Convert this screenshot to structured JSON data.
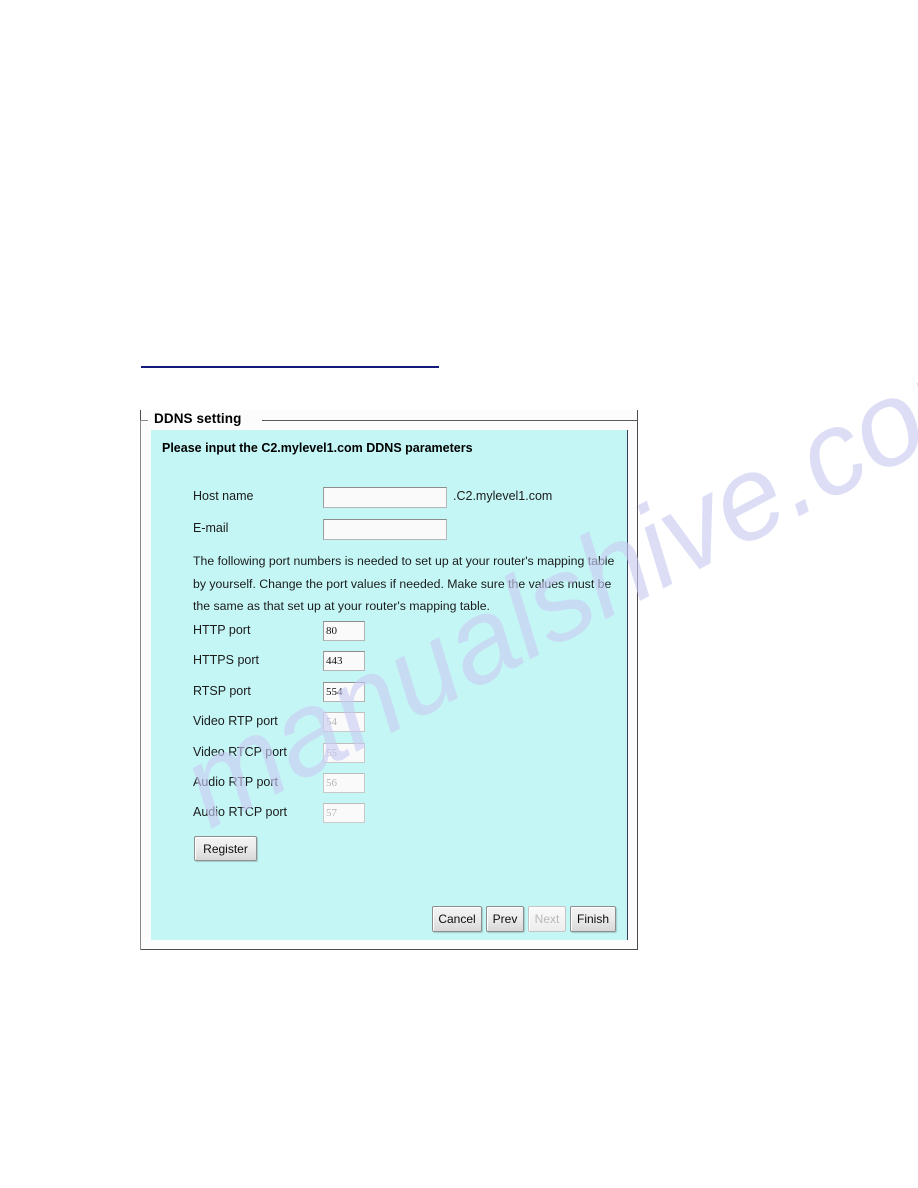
{
  "page": {
    "background_color": "#ffffff",
    "rule_color": "#141b7a"
  },
  "watermark": {
    "text": "manualshive.com",
    "color": "#c9cbf2"
  },
  "fieldset": {
    "legend": "DDNS setting"
  },
  "panel": {
    "background_color": "#c5f6f6",
    "heading": "Please input the C2.mylevel1.com DDNS parameters",
    "note": [
      "The following port numbers is needed to set up at your router's mapping table",
      "by yourself. Change the port values if needed. Make sure the values must be",
      "the same as that set up at your router's mapping table."
    ]
  },
  "fields": {
    "host_name": {
      "label": "Host name",
      "value": "",
      "suffix": ".C2.mylevel1.com"
    },
    "email": {
      "label": "E-mail",
      "value": ""
    },
    "http_port": {
      "label": "HTTP port",
      "value": "80"
    },
    "https_port": {
      "label": "HTTPS port",
      "value": "443"
    },
    "rtsp_port": {
      "label": "RTSP port",
      "value": "554"
    },
    "video_rtp_port": {
      "label": "Video RTP port",
      "value": "54"
    },
    "video_rtcp_port": {
      "label": "Video RTCP port",
      "value": "55"
    },
    "audio_rtp_port": {
      "label": "Audio RTP port",
      "value": "56"
    },
    "audio_rtcp_port": {
      "label": "Audio RTCP port",
      "value": "57"
    }
  },
  "buttons": {
    "register": "Register",
    "cancel": "Cancel",
    "prev": "Prev",
    "next": "Next",
    "finish": "Finish"
  }
}
